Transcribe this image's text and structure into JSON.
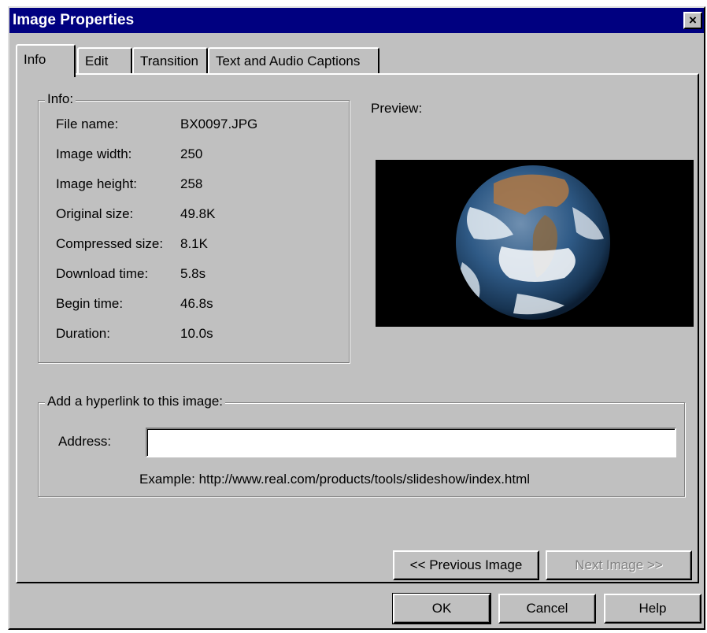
{
  "window": {
    "title": "Image Properties",
    "close_label": "×"
  },
  "tabs": [
    {
      "label": "Info",
      "active": true
    },
    {
      "label": "Edit",
      "active": false
    },
    {
      "label": "Transition",
      "active": false
    },
    {
      "label": "Text and Audio Captions",
      "active": false
    }
  ],
  "info": {
    "legend": "Info:",
    "rows": [
      {
        "label": "File name:",
        "value": "BX0097.JPG"
      },
      {
        "label": "Image width:",
        "value": "250"
      },
      {
        "label": "Image height:",
        "value": "258"
      },
      {
        "label": "Original size:",
        "value": "49.8K"
      },
      {
        "label": "Compressed size:",
        "value": "8.1K"
      },
      {
        "label": "Download time:",
        "value": "5.8s"
      },
      {
        "label": "Begin time:",
        "value": "46.8s"
      },
      {
        "label": "Duration:",
        "value": "10.0s"
      }
    ]
  },
  "preview": {
    "label": "Preview:",
    "image_icon": "earth-image"
  },
  "hyperlink": {
    "legend": "Add a hyperlink to this image:",
    "address_label": "Address:",
    "address_value": "",
    "example": "Example: http://www.real.com/products/tools/slideshow/index.html"
  },
  "nav": {
    "previous_label": "<< Previous Image",
    "next_label": "Next Image >>"
  },
  "buttons": {
    "ok": "OK",
    "cancel": "Cancel",
    "help": "Help"
  },
  "colors": {
    "titlebar": "#000080",
    "face": "#c0c0c0",
    "preview_bg": "#000000"
  }
}
